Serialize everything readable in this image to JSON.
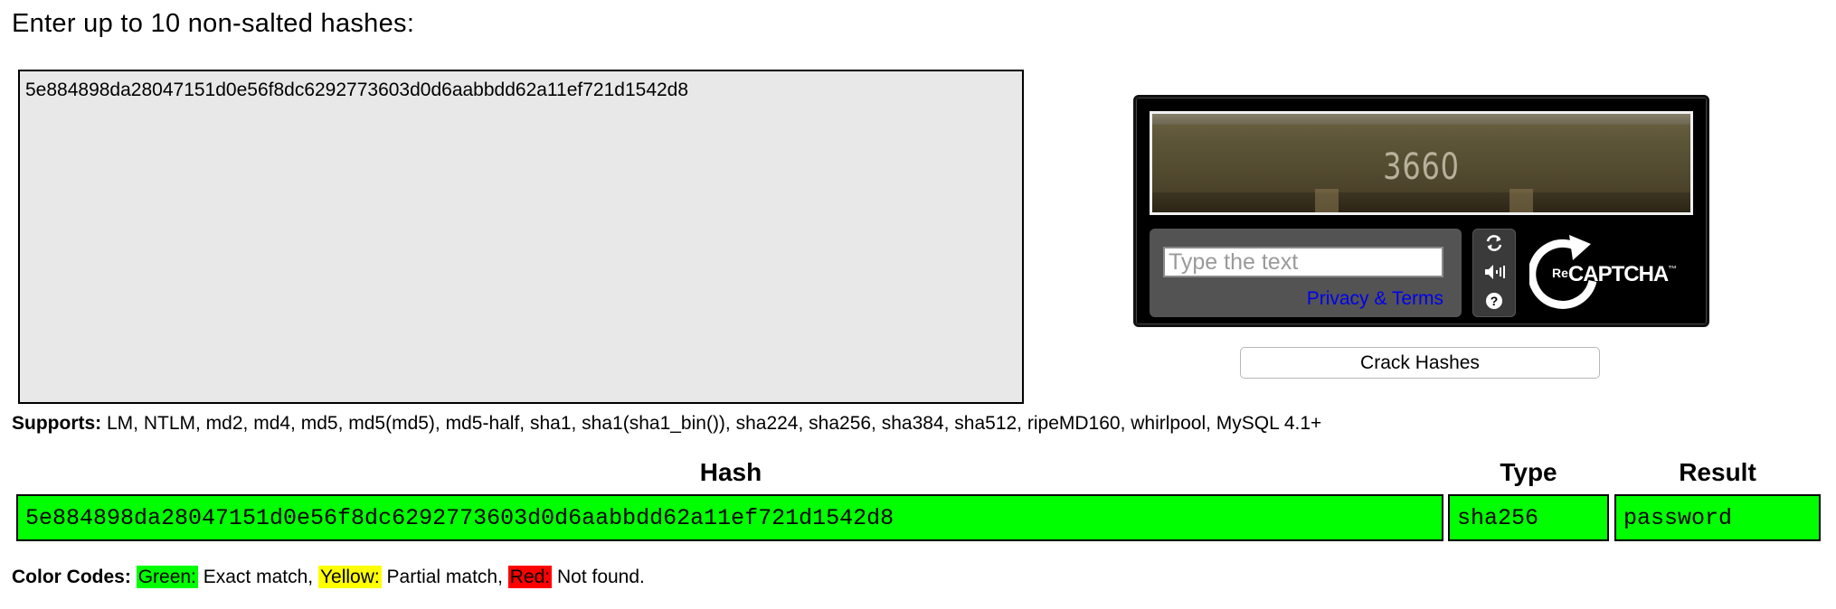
{
  "prompt_label": "Enter up to 10 non-salted hashes:",
  "hash_input": {
    "value": "5e884898da28047151d0e56f8dc6292773603d0d6aabbdd62a11ef721d1542d8"
  },
  "captcha": {
    "image_word": "3660",
    "input_placeholder": "Type the text",
    "privacy_link": "Privacy & Terms",
    "logo_re": "Re",
    "logo_captcha": "CAPTCHA",
    "logo_tm": "™",
    "refresh_icon": "refresh-icon",
    "audio_icon": "audio-icon",
    "help_icon": "help-icon",
    "help_glyph": "?"
  },
  "crack_button_label": "Crack Hashes",
  "supports": {
    "label": "Supports:",
    "text": "LM, NTLM, md2, md4, md5, md5(md5), md5-half, sha1, sha1(sha1_bin()), sha224, sha256, sha384, sha512, ripeMD160, whirlpool, MySQL 4.1+"
  },
  "results": {
    "headers": {
      "hash": "Hash",
      "type": "Type",
      "result": "Result"
    },
    "rows": [
      {
        "hash": "5e884898da28047151d0e56f8dc6292773603d0d6aabbdd62a11ef721d1542d8",
        "type": "sha256",
        "result": "password",
        "status_color": "#00ff00"
      }
    ]
  },
  "color_codes": {
    "label": "Color Codes:",
    "green_label": "Green:",
    "green_desc": " Exact match, ",
    "yellow_label": "Yellow:",
    "yellow_desc": " Partial match, ",
    "red_label": "Red:",
    "red_desc": " Not found.",
    "green": "#00ff00",
    "yellow": "#ffff00",
    "red": "#ff0000"
  }
}
